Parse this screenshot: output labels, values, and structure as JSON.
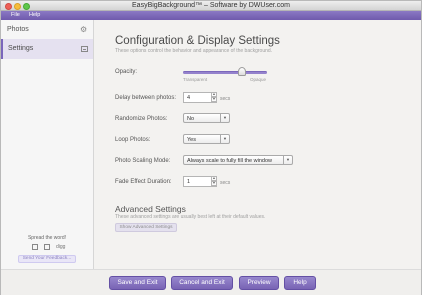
{
  "window": {
    "title": "EasyBigBackground™ – Software by DWUser.com"
  },
  "menubar": {
    "items": [
      "File",
      "Help"
    ]
  },
  "sidebar": {
    "items": [
      {
        "label": "Photos",
        "icon": "gear-icon"
      },
      {
        "label": "Settings",
        "icon": "image-icon"
      }
    ],
    "spread_text": "Spread the word!",
    "social": [
      "facebook-icon",
      "twitter-icon",
      "digg-icon"
    ],
    "digg_label": "digg",
    "feedback_label": "Send Your Feedback..."
  },
  "main": {
    "title": "Configuration & Display Settings",
    "subtitle": "These options control the behavior and appearance of the background.",
    "opacity": {
      "label": "Opacity:",
      "min_label": "Transparent",
      "max_label": "Opaque",
      "value": 0.7
    },
    "delay": {
      "label": "Delay between photos:",
      "value": "4",
      "unit": "secs"
    },
    "randomize": {
      "label": "Randomize Photos:",
      "value": "No"
    },
    "loop": {
      "label": "Loop Photos:",
      "value": "Yes"
    },
    "scaling": {
      "label": "Photo Scaling Mode:",
      "value": "Always scale to fully fill the window"
    },
    "fade": {
      "label": "Fade Effect Duration:",
      "value": "1",
      "unit": "secs"
    },
    "advanced": {
      "title": "Advanced Settings",
      "subtitle": "These advanced settings are usually best left at their default values.",
      "button": "Show Advanced Settings"
    }
  },
  "footer": {
    "save_exit": "Save and Exit",
    "cancel_exit": "Cancel and Exit",
    "preview": "Preview",
    "help": "Help"
  },
  "colors": {
    "accent": "#7a66bb",
    "button": "#8673c2"
  }
}
